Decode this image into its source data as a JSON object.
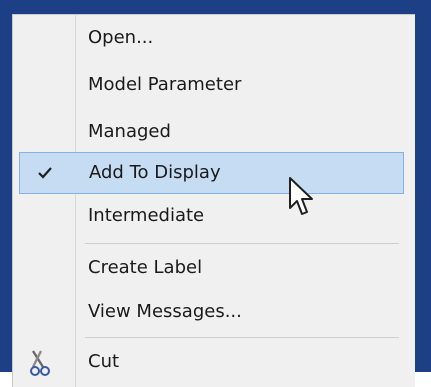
{
  "menu": {
    "items": [
      {
        "label": "Open..."
      },
      {
        "label": "Model Parameter"
      },
      {
        "label": "Managed"
      },
      {
        "label": "Add To Display",
        "checked": true,
        "selected": true
      },
      {
        "label": "Intermediate"
      },
      {
        "label": "Create Label"
      },
      {
        "label": "View Messages..."
      },
      {
        "label": "Cut",
        "icon": "scissors-icon"
      }
    ]
  },
  "colors": {
    "frame": "#1c3f86",
    "menu_bg": "#f0f0f0",
    "highlight_bg": "#c5dcf3",
    "highlight_border": "#86b1e4"
  },
  "icons": {
    "check": "checkmark-icon",
    "cut": "scissors-icon",
    "pointer": "mouse-pointer-icon"
  }
}
